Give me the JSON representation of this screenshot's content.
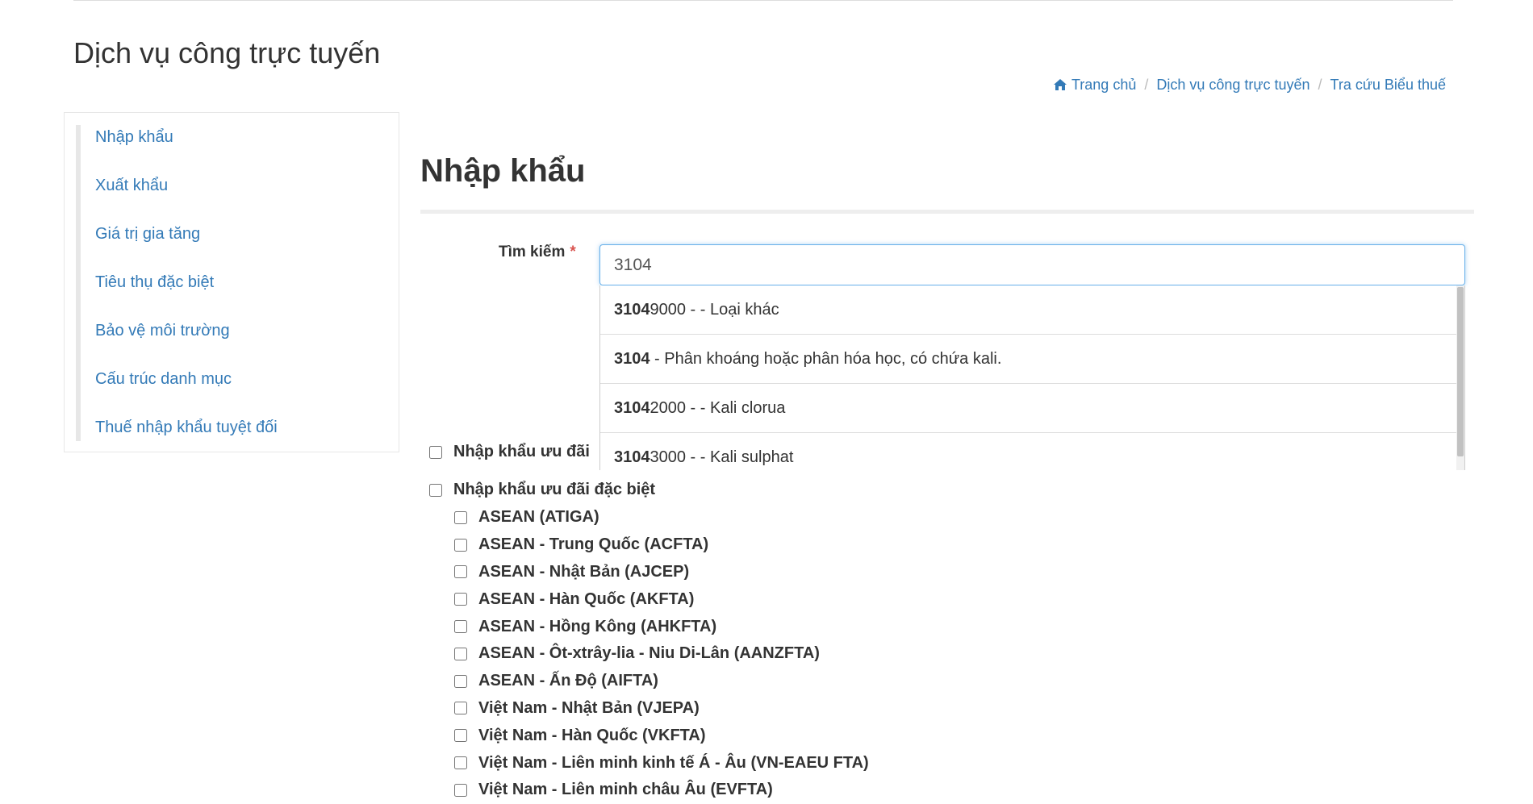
{
  "header": {
    "title": "Dịch vụ công trực tuyến"
  },
  "breadcrumb": {
    "home_icon": "home-icon",
    "items": [
      "Trang chủ",
      "Dịch vụ công trực tuyến",
      "Tra cứu Biểu thuế"
    ],
    "separator": "/"
  },
  "sidebar": {
    "items": [
      {
        "label": "Nhập khẩu"
      },
      {
        "label": "Xuất khẩu"
      },
      {
        "label": "Giá trị gia tăng"
      },
      {
        "label": "Tiêu thụ đặc biệt"
      },
      {
        "label": "Bảo vệ môi trường"
      },
      {
        "label": "Cấu trúc danh mục"
      },
      {
        "label": "Thuế nhập khẩu tuyệt đối"
      }
    ]
  },
  "main": {
    "title": "Nhập khẩu",
    "search": {
      "label": "Tìm kiếm",
      "required_mark": "*",
      "value": "3104"
    },
    "suggestions": [
      {
        "code_match": "3104",
        "code_rest": "9000",
        "desc": " - - Loại khác"
      },
      {
        "code_match": "3104",
        "code_rest": "",
        "desc": " - Phân khoáng hoặc phân hóa học, có chứa kali."
      },
      {
        "code_match": "3104",
        "code_rest": "2000",
        "desc": " - - Kali clorua"
      },
      {
        "code_match": "3104",
        "code_rest": "3000",
        "desc": " - - Kali sulphat"
      }
    ],
    "options": {
      "preferential": "Nhập khẩu ưu đãi",
      "special_preferential": "Nhập khẩu ưu đãi đặc biệt",
      "ftas": [
        "ASEAN (ATIGA)",
        "ASEAN - Trung Quốc (ACFTA)",
        "ASEAN - Nhật Bản (AJCEP)",
        "ASEAN - Hàn Quốc (AKFTA)",
        "ASEAN - Hồng Kông (AHKFTA)",
        "ASEAN - Ôt-xtrây-lia - Niu Di-Lân (AANZFTA)",
        "ASEAN - Ấn Độ (AIFTA)",
        "Việt Nam - Nhật Bản (VJEPA)",
        "Việt Nam - Hàn Quốc (VKFTA)",
        "Việt Nam - Liên minh kinh tế Á - Âu (VN-EAEU FTA)",
        "Việt Nam - Liên minh châu Âu (EVFTA)"
      ]
    }
  },
  "colors": {
    "link": "#337ab7",
    "required": "#d9534f",
    "focus_border": "#66afe9"
  }
}
